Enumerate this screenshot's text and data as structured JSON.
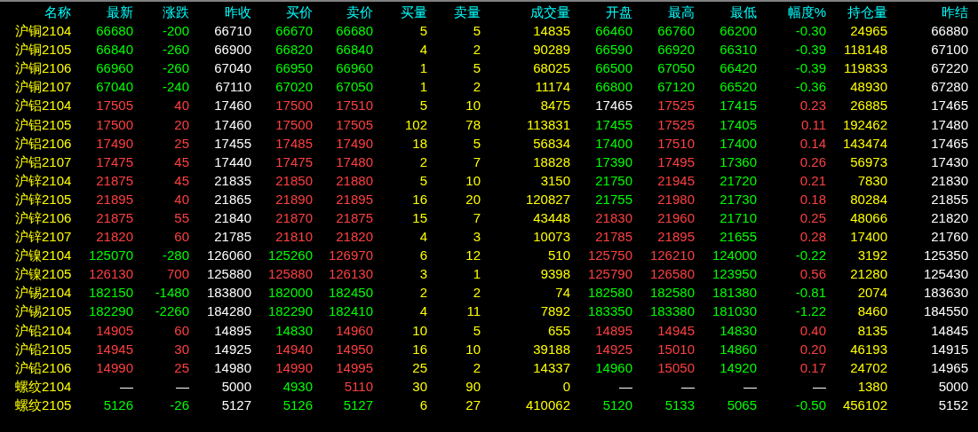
{
  "table": {
    "columns": [
      "名称",
      "最新",
      "涨跌",
      "昨收",
      "买价",
      "卖价",
      "买量",
      "卖量",
      "成交量",
      "开盘",
      "最高",
      "最低",
      "幅度%",
      "持仓量",
      "昨结"
    ],
    "rows": [
      {
        "cells": [
          {
            "text": "沪铜2104",
            "color": "#ffff00"
          },
          {
            "text": "66680",
            "color": "#00ff00"
          },
          {
            "text": "-200",
            "color": "#00ff00"
          },
          {
            "text": "66710",
            "color": "#ffffff"
          },
          {
            "text": "66670",
            "color": "#00ff00"
          },
          {
            "text": "66680",
            "color": "#00ff00"
          },
          {
            "text": "5",
            "color": "#ffff00"
          },
          {
            "text": "5",
            "color": "#ffff00"
          },
          {
            "text": "14835",
            "color": "#ffff00"
          },
          {
            "text": "66460",
            "color": "#00ff00"
          },
          {
            "text": "66760",
            "color": "#00ff00"
          },
          {
            "text": "66200",
            "color": "#00ff00"
          },
          {
            "text": "-0.30",
            "color": "#00ff00"
          },
          {
            "text": "24965",
            "color": "#ffff00"
          },
          {
            "text": "66880",
            "color": "#ffffff"
          }
        ]
      },
      {
        "cells": [
          {
            "text": "沪铜2105",
            "color": "#ffff00"
          },
          {
            "text": "66840",
            "color": "#00ff00"
          },
          {
            "text": "-260",
            "color": "#00ff00"
          },
          {
            "text": "66900",
            "color": "#ffffff"
          },
          {
            "text": "66820",
            "color": "#00ff00"
          },
          {
            "text": "66840",
            "color": "#00ff00"
          },
          {
            "text": "4",
            "color": "#ffff00"
          },
          {
            "text": "2",
            "color": "#ffff00"
          },
          {
            "text": "90289",
            "color": "#ffff00"
          },
          {
            "text": "66590",
            "color": "#00ff00"
          },
          {
            "text": "66920",
            "color": "#00ff00"
          },
          {
            "text": "66310",
            "color": "#00ff00"
          },
          {
            "text": "-0.39",
            "color": "#00ff00"
          },
          {
            "text": "118148",
            "color": "#ffff00"
          },
          {
            "text": "67100",
            "color": "#ffffff"
          }
        ]
      },
      {
        "cells": [
          {
            "text": "沪铜2106",
            "color": "#ffff00"
          },
          {
            "text": "66960",
            "color": "#00ff00"
          },
          {
            "text": "-260",
            "color": "#00ff00"
          },
          {
            "text": "67040",
            "color": "#ffffff"
          },
          {
            "text": "66950",
            "color": "#00ff00"
          },
          {
            "text": "66960",
            "color": "#00ff00"
          },
          {
            "text": "1",
            "color": "#ffff00"
          },
          {
            "text": "5",
            "color": "#ffff00"
          },
          {
            "text": "68025",
            "color": "#ffff00"
          },
          {
            "text": "66500",
            "color": "#00ff00"
          },
          {
            "text": "67050",
            "color": "#00ff00"
          },
          {
            "text": "66420",
            "color": "#00ff00"
          },
          {
            "text": "-0.39",
            "color": "#00ff00"
          },
          {
            "text": "119833",
            "color": "#ffff00"
          },
          {
            "text": "67220",
            "color": "#ffffff"
          }
        ]
      },
      {
        "cells": [
          {
            "text": "沪铜2107",
            "color": "#ffff00"
          },
          {
            "text": "67040",
            "color": "#00ff00"
          },
          {
            "text": "-240",
            "color": "#00ff00"
          },
          {
            "text": "67110",
            "color": "#ffffff"
          },
          {
            "text": "67020",
            "color": "#00ff00"
          },
          {
            "text": "67050",
            "color": "#00ff00"
          },
          {
            "text": "1",
            "color": "#ffff00"
          },
          {
            "text": "2",
            "color": "#ffff00"
          },
          {
            "text": "11174",
            "color": "#ffff00"
          },
          {
            "text": "66800",
            "color": "#00ff00"
          },
          {
            "text": "67120",
            "color": "#00ff00"
          },
          {
            "text": "66520",
            "color": "#00ff00"
          },
          {
            "text": "-0.36",
            "color": "#00ff00"
          },
          {
            "text": "48930",
            "color": "#ffff00"
          },
          {
            "text": "67280",
            "color": "#ffffff"
          }
        ]
      },
      {
        "cells": [
          {
            "text": "沪铝2104",
            "color": "#ffff00"
          },
          {
            "text": "17505",
            "color": "#ff4040"
          },
          {
            "text": "40",
            "color": "#ff4040"
          },
          {
            "text": "17460",
            "color": "#ffffff"
          },
          {
            "text": "17500",
            "color": "#ff4040"
          },
          {
            "text": "17510",
            "color": "#ff4040"
          },
          {
            "text": "5",
            "color": "#ffff00"
          },
          {
            "text": "10",
            "color": "#ffff00"
          },
          {
            "text": "8475",
            "color": "#ffff00"
          },
          {
            "text": "17465",
            "color": "#ffffff"
          },
          {
            "text": "17525",
            "color": "#ff4040"
          },
          {
            "text": "17415",
            "color": "#00ff00"
          },
          {
            "text": "0.23",
            "color": "#ff4040"
          },
          {
            "text": "26885",
            "color": "#ffff00"
          },
          {
            "text": "17465",
            "color": "#ffffff"
          }
        ]
      },
      {
        "cells": [
          {
            "text": "沪铝2105",
            "color": "#ffff00"
          },
          {
            "text": "17500",
            "color": "#ff4040"
          },
          {
            "text": "20",
            "color": "#ff4040"
          },
          {
            "text": "17460",
            "color": "#ffffff"
          },
          {
            "text": "17500",
            "color": "#ff4040"
          },
          {
            "text": "17505",
            "color": "#ff4040"
          },
          {
            "text": "102",
            "color": "#ffff00"
          },
          {
            "text": "78",
            "color": "#ffff00"
          },
          {
            "text": "113831",
            "color": "#ffff00"
          },
          {
            "text": "17455",
            "color": "#00ff00"
          },
          {
            "text": "17525",
            "color": "#ff4040"
          },
          {
            "text": "17405",
            "color": "#00ff00"
          },
          {
            "text": "0.11",
            "color": "#ff4040"
          },
          {
            "text": "192462",
            "color": "#ffff00"
          },
          {
            "text": "17480",
            "color": "#ffffff"
          }
        ]
      },
      {
        "cells": [
          {
            "text": "沪铝2106",
            "color": "#ffff00"
          },
          {
            "text": "17490",
            "color": "#ff4040"
          },
          {
            "text": "25",
            "color": "#ff4040"
          },
          {
            "text": "17455",
            "color": "#ffffff"
          },
          {
            "text": "17485",
            "color": "#ff4040"
          },
          {
            "text": "17490",
            "color": "#ff4040"
          },
          {
            "text": "18",
            "color": "#ffff00"
          },
          {
            "text": "5",
            "color": "#ffff00"
          },
          {
            "text": "56834",
            "color": "#ffff00"
          },
          {
            "text": "17400",
            "color": "#00ff00"
          },
          {
            "text": "17510",
            "color": "#ff4040"
          },
          {
            "text": "17400",
            "color": "#00ff00"
          },
          {
            "text": "0.14",
            "color": "#ff4040"
          },
          {
            "text": "143474",
            "color": "#ffff00"
          },
          {
            "text": "17465",
            "color": "#ffffff"
          }
        ]
      },
      {
        "cells": [
          {
            "text": "沪铝2107",
            "color": "#ffff00"
          },
          {
            "text": "17475",
            "color": "#ff4040"
          },
          {
            "text": "45",
            "color": "#ff4040"
          },
          {
            "text": "17440",
            "color": "#ffffff"
          },
          {
            "text": "17475",
            "color": "#ff4040"
          },
          {
            "text": "17480",
            "color": "#ff4040"
          },
          {
            "text": "2",
            "color": "#ffff00"
          },
          {
            "text": "7",
            "color": "#ffff00"
          },
          {
            "text": "18828",
            "color": "#ffff00"
          },
          {
            "text": "17390",
            "color": "#00ff00"
          },
          {
            "text": "17495",
            "color": "#ff4040"
          },
          {
            "text": "17360",
            "color": "#00ff00"
          },
          {
            "text": "0.26",
            "color": "#ff4040"
          },
          {
            "text": "56973",
            "color": "#ffff00"
          },
          {
            "text": "17430",
            "color": "#ffffff"
          }
        ]
      },
      {
        "cells": [
          {
            "text": "沪锌2104",
            "color": "#ffff00"
          },
          {
            "text": "21875",
            "color": "#ff4040"
          },
          {
            "text": "45",
            "color": "#ff4040"
          },
          {
            "text": "21835",
            "color": "#ffffff"
          },
          {
            "text": "21850",
            "color": "#ff4040"
          },
          {
            "text": "21880",
            "color": "#ff4040"
          },
          {
            "text": "5",
            "color": "#ffff00"
          },
          {
            "text": "10",
            "color": "#ffff00"
          },
          {
            "text": "3150",
            "color": "#ffff00"
          },
          {
            "text": "21750",
            "color": "#00ff00"
          },
          {
            "text": "21945",
            "color": "#ff4040"
          },
          {
            "text": "21720",
            "color": "#00ff00"
          },
          {
            "text": "0.21",
            "color": "#ff4040"
          },
          {
            "text": "7830",
            "color": "#ffff00"
          },
          {
            "text": "21830",
            "color": "#ffffff"
          }
        ]
      },
      {
        "cells": [
          {
            "text": "沪锌2105",
            "color": "#ffff00"
          },
          {
            "text": "21895",
            "color": "#ff4040"
          },
          {
            "text": "40",
            "color": "#ff4040"
          },
          {
            "text": "21865",
            "color": "#ffffff"
          },
          {
            "text": "21890",
            "color": "#ff4040"
          },
          {
            "text": "21895",
            "color": "#ff4040"
          },
          {
            "text": "16",
            "color": "#ffff00"
          },
          {
            "text": "20",
            "color": "#ffff00"
          },
          {
            "text": "120827",
            "color": "#ffff00"
          },
          {
            "text": "21755",
            "color": "#00ff00"
          },
          {
            "text": "21980",
            "color": "#ff4040"
          },
          {
            "text": "21730",
            "color": "#00ff00"
          },
          {
            "text": "0.18",
            "color": "#ff4040"
          },
          {
            "text": "80284",
            "color": "#ffff00"
          },
          {
            "text": "21855",
            "color": "#ffffff"
          }
        ]
      },
      {
        "cells": [
          {
            "text": "沪锌2106",
            "color": "#ffff00"
          },
          {
            "text": "21875",
            "color": "#ff4040"
          },
          {
            "text": "55",
            "color": "#ff4040"
          },
          {
            "text": "21840",
            "color": "#ffffff"
          },
          {
            "text": "21870",
            "color": "#ff4040"
          },
          {
            "text": "21875",
            "color": "#ff4040"
          },
          {
            "text": "15",
            "color": "#ffff00"
          },
          {
            "text": "7",
            "color": "#ffff00"
          },
          {
            "text": "43448",
            "color": "#ffff00"
          },
          {
            "text": "21830",
            "color": "#ff4040"
          },
          {
            "text": "21960",
            "color": "#ff4040"
          },
          {
            "text": "21710",
            "color": "#00ff00"
          },
          {
            "text": "0.25",
            "color": "#ff4040"
          },
          {
            "text": "48066",
            "color": "#ffff00"
          },
          {
            "text": "21820",
            "color": "#ffffff"
          }
        ]
      },
      {
        "cells": [
          {
            "text": "沪锌2107",
            "color": "#ffff00"
          },
          {
            "text": "21820",
            "color": "#ff4040"
          },
          {
            "text": "60",
            "color": "#ff4040"
          },
          {
            "text": "21785",
            "color": "#ffffff"
          },
          {
            "text": "21810",
            "color": "#ff4040"
          },
          {
            "text": "21820",
            "color": "#ff4040"
          },
          {
            "text": "4",
            "color": "#ffff00"
          },
          {
            "text": "3",
            "color": "#ffff00"
          },
          {
            "text": "10073",
            "color": "#ffff00"
          },
          {
            "text": "21785",
            "color": "#ff4040"
          },
          {
            "text": "21895",
            "color": "#ff4040"
          },
          {
            "text": "21655",
            "color": "#00ff00"
          },
          {
            "text": "0.28",
            "color": "#ff4040"
          },
          {
            "text": "17400",
            "color": "#ffff00"
          },
          {
            "text": "21760",
            "color": "#ffffff"
          }
        ]
      },
      {
        "cells": [
          {
            "text": "沪镍2104",
            "color": "#ffff00"
          },
          {
            "text": "125070",
            "color": "#00ff00"
          },
          {
            "text": "-280",
            "color": "#00ff00"
          },
          {
            "text": "126060",
            "color": "#ffffff"
          },
          {
            "text": "125260",
            "color": "#00ff00"
          },
          {
            "text": "126970",
            "color": "#ff4040"
          },
          {
            "text": "6",
            "color": "#ffff00"
          },
          {
            "text": "12",
            "color": "#ffff00"
          },
          {
            "text": "510",
            "color": "#ffff00"
          },
          {
            "text": "125750",
            "color": "#ff4040"
          },
          {
            "text": "126210",
            "color": "#ff4040"
          },
          {
            "text": "124000",
            "color": "#00ff00"
          },
          {
            "text": "-0.22",
            "color": "#00ff00"
          },
          {
            "text": "3192",
            "color": "#ffff00"
          },
          {
            "text": "125350",
            "color": "#ffffff"
          }
        ]
      },
      {
        "cells": [
          {
            "text": "沪镍2105",
            "color": "#ffff00"
          },
          {
            "text": "126130",
            "color": "#ff4040"
          },
          {
            "text": "700",
            "color": "#ff4040"
          },
          {
            "text": "125880",
            "color": "#ffffff"
          },
          {
            "text": "125880",
            "color": "#ff4040"
          },
          {
            "text": "126130",
            "color": "#ff4040"
          },
          {
            "text": "3",
            "color": "#ffff00"
          },
          {
            "text": "1",
            "color": "#ffff00"
          },
          {
            "text": "9398",
            "color": "#ffff00"
          },
          {
            "text": "125790",
            "color": "#ff4040"
          },
          {
            "text": "126580",
            "color": "#ff4040"
          },
          {
            "text": "123950",
            "color": "#00ff00"
          },
          {
            "text": "0.56",
            "color": "#ff4040"
          },
          {
            "text": "21280",
            "color": "#ffff00"
          },
          {
            "text": "125430",
            "color": "#ffffff"
          }
        ]
      },
      {
        "cells": [
          {
            "text": "沪锡2104",
            "color": "#ffff00"
          },
          {
            "text": "182150",
            "color": "#00ff00"
          },
          {
            "text": "-1480",
            "color": "#00ff00"
          },
          {
            "text": "183800",
            "color": "#ffffff"
          },
          {
            "text": "182000",
            "color": "#00ff00"
          },
          {
            "text": "182450",
            "color": "#00ff00"
          },
          {
            "text": "2",
            "color": "#ffff00"
          },
          {
            "text": "2",
            "color": "#ffff00"
          },
          {
            "text": "74",
            "color": "#ffff00"
          },
          {
            "text": "182580",
            "color": "#00ff00"
          },
          {
            "text": "182580",
            "color": "#00ff00"
          },
          {
            "text": "181380",
            "color": "#00ff00"
          },
          {
            "text": "-0.81",
            "color": "#00ff00"
          },
          {
            "text": "2074",
            "color": "#ffff00"
          },
          {
            "text": "183630",
            "color": "#ffffff"
          }
        ]
      },
      {
        "cells": [
          {
            "text": "沪锡2105",
            "color": "#ffff00"
          },
          {
            "text": "182290",
            "color": "#00ff00"
          },
          {
            "text": "-2260",
            "color": "#00ff00"
          },
          {
            "text": "184280",
            "color": "#ffffff"
          },
          {
            "text": "182290",
            "color": "#00ff00"
          },
          {
            "text": "182410",
            "color": "#00ff00"
          },
          {
            "text": "4",
            "color": "#ffff00"
          },
          {
            "text": "11",
            "color": "#ffff00"
          },
          {
            "text": "7892",
            "color": "#ffff00"
          },
          {
            "text": "183350",
            "color": "#00ff00"
          },
          {
            "text": "183380",
            "color": "#00ff00"
          },
          {
            "text": "181030",
            "color": "#00ff00"
          },
          {
            "text": "-1.22",
            "color": "#00ff00"
          },
          {
            "text": "8460",
            "color": "#ffff00"
          },
          {
            "text": "184550",
            "color": "#ffffff"
          }
        ]
      },
      {
        "cells": [
          {
            "text": "沪铅2104",
            "color": "#ffff00"
          },
          {
            "text": "14905",
            "color": "#ff4040"
          },
          {
            "text": "60",
            "color": "#ff4040"
          },
          {
            "text": "14895",
            "color": "#ffffff"
          },
          {
            "text": "14830",
            "color": "#00ff00"
          },
          {
            "text": "14960",
            "color": "#ff4040"
          },
          {
            "text": "10",
            "color": "#ffff00"
          },
          {
            "text": "5",
            "color": "#ffff00"
          },
          {
            "text": "655",
            "color": "#ffff00"
          },
          {
            "text": "14895",
            "color": "#ff4040"
          },
          {
            "text": "14945",
            "color": "#ff4040"
          },
          {
            "text": "14830",
            "color": "#00ff00"
          },
          {
            "text": "0.40",
            "color": "#ff4040"
          },
          {
            "text": "8135",
            "color": "#ffff00"
          },
          {
            "text": "14845",
            "color": "#ffffff"
          }
        ]
      },
      {
        "cells": [
          {
            "text": "沪铅2105",
            "color": "#ffff00"
          },
          {
            "text": "14945",
            "color": "#ff4040"
          },
          {
            "text": "30",
            "color": "#ff4040"
          },
          {
            "text": "14925",
            "color": "#ffffff"
          },
          {
            "text": "14940",
            "color": "#ff4040"
          },
          {
            "text": "14950",
            "color": "#ff4040"
          },
          {
            "text": "16",
            "color": "#ffff00"
          },
          {
            "text": "10",
            "color": "#ffff00"
          },
          {
            "text": "39188",
            "color": "#ffff00"
          },
          {
            "text": "14925",
            "color": "#ff4040"
          },
          {
            "text": "15010",
            "color": "#ff4040"
          },
          {
            "text": "14860",
            "color": "#00ff00"
          },
          {
            "text": "0.20",
            "color": "#ff4040"
          },
          {
            "text": "46193",
            "color": "#ffff00"
          },
          {
            "text": "14915",
            "color": "#ffffff"
          }
        ]
      },
      {
        "cells": [
          {
            "text": "沪铅2106",
            "color": "#ffff00"
          },
          {
            "text": "14990",
            "color": "#ff4040"
          },
          {
            "text": "25",
            "color": "#ff4040"
          },
          {
            "text": "14980",
            "color": "#ffffff"
          },
          {
            "text": "14990",
            "color": "#ff4040"
          },
          {
            "text": "14995",
            "color": "#ff4040"
          },
          {
            "text": "25",
            "color": "#ffff00"
          },
          {
            "text": "2",
            "color": "#ffff00"
          },
          {
            "text": "14337",
            "color": "#ffff00"
          },
          {
            "text": "14960",
            "color": "#00ff00"
          },
          {
            "text": "15050",
            "color": "#ff4040"
          },
          {
            "text": "14920",
            "color": "#00ff00"
          },
          {
            "text": "0.17",
            "color": "#ff4040"
          },
          {
            "text": "24702",
            "color": "#ffff00"
          },
          {
            "text": "14965",
            "color": "#ffffff"
          }
        ]
      },
      {
        "cells": [
          {
            "text": "螺纹2104",
            "color": "#ffff00"
          },
          {
            "text": "—",
            "color": "#ffffff"
          },
          {
            "text": "—",
            "color": "#ffffff"
          },
          {
            "text": "5000",
            "color": "#ffffff"
          },
          {
            "text": "4930",
            "color": "#00ff00"
          },
          {
            "text": "5110",
            "color": "#ff4040"
          },
          {
            "text": "30",
            "color": "#ffff00"
          },
          {
            "text": "90",
            "color": "#ffff00"
          },
          {
            "text": "0",
            "color": "#ffff00"
          },
          {
            "text": "—",
            "color": "#ffffff"
          },
          {
            "text": "—",
            "color": "#ffffff"
          },
          {
            "text": "—",
            "color": "#ffffff"
          },
          {
            "text": "—",
            "color": "#ffffff"
          },
          {
            "text": "1380",
            "color": "#ffff00"
          },
          {
            "text": "5000",
            "color": "#ffffff"
          }
        ]
      },
      {
        "cells": [
          {
            "text": "螺纹2105",
            "color": "#ffff00"
          },
          {
            "text": "5126",
            "color": "#00ff00"
          },
          {
            "text": "-26",
            "color": "#00ff00"
          },
          {
            "text": "5127",
            "color": "#ffffff"
          },
          {
            "text": "5126",
            "color": "#00ff00"
          },
          {
            "text": "5127",
            "color": "#00ff00"
          },
          {
            "text": "6",
            "color": "#ffff00"
          },
          {
            "text": "27",
            "color": "#ffff00"
          },
          {
            "text": "410062",
            "color": "#ffff00"
          },
          {
            "text": "5120",
            "color": "#00ff00"
          },
          {
            "text": "5133",
            "color": "#00ff00"
          },
          {
            "text": "5065",
            "color": "#00ff00"
          },
          {
            "text": "-0.50",
            "color": "#00ff00"
          },
          {
            "text": "456102",
            "color": "#ffff00"
          },
          {
            "text": "5152",
            "color": "#ffffff"
          }
        ]
      }
    ]
  }
}
